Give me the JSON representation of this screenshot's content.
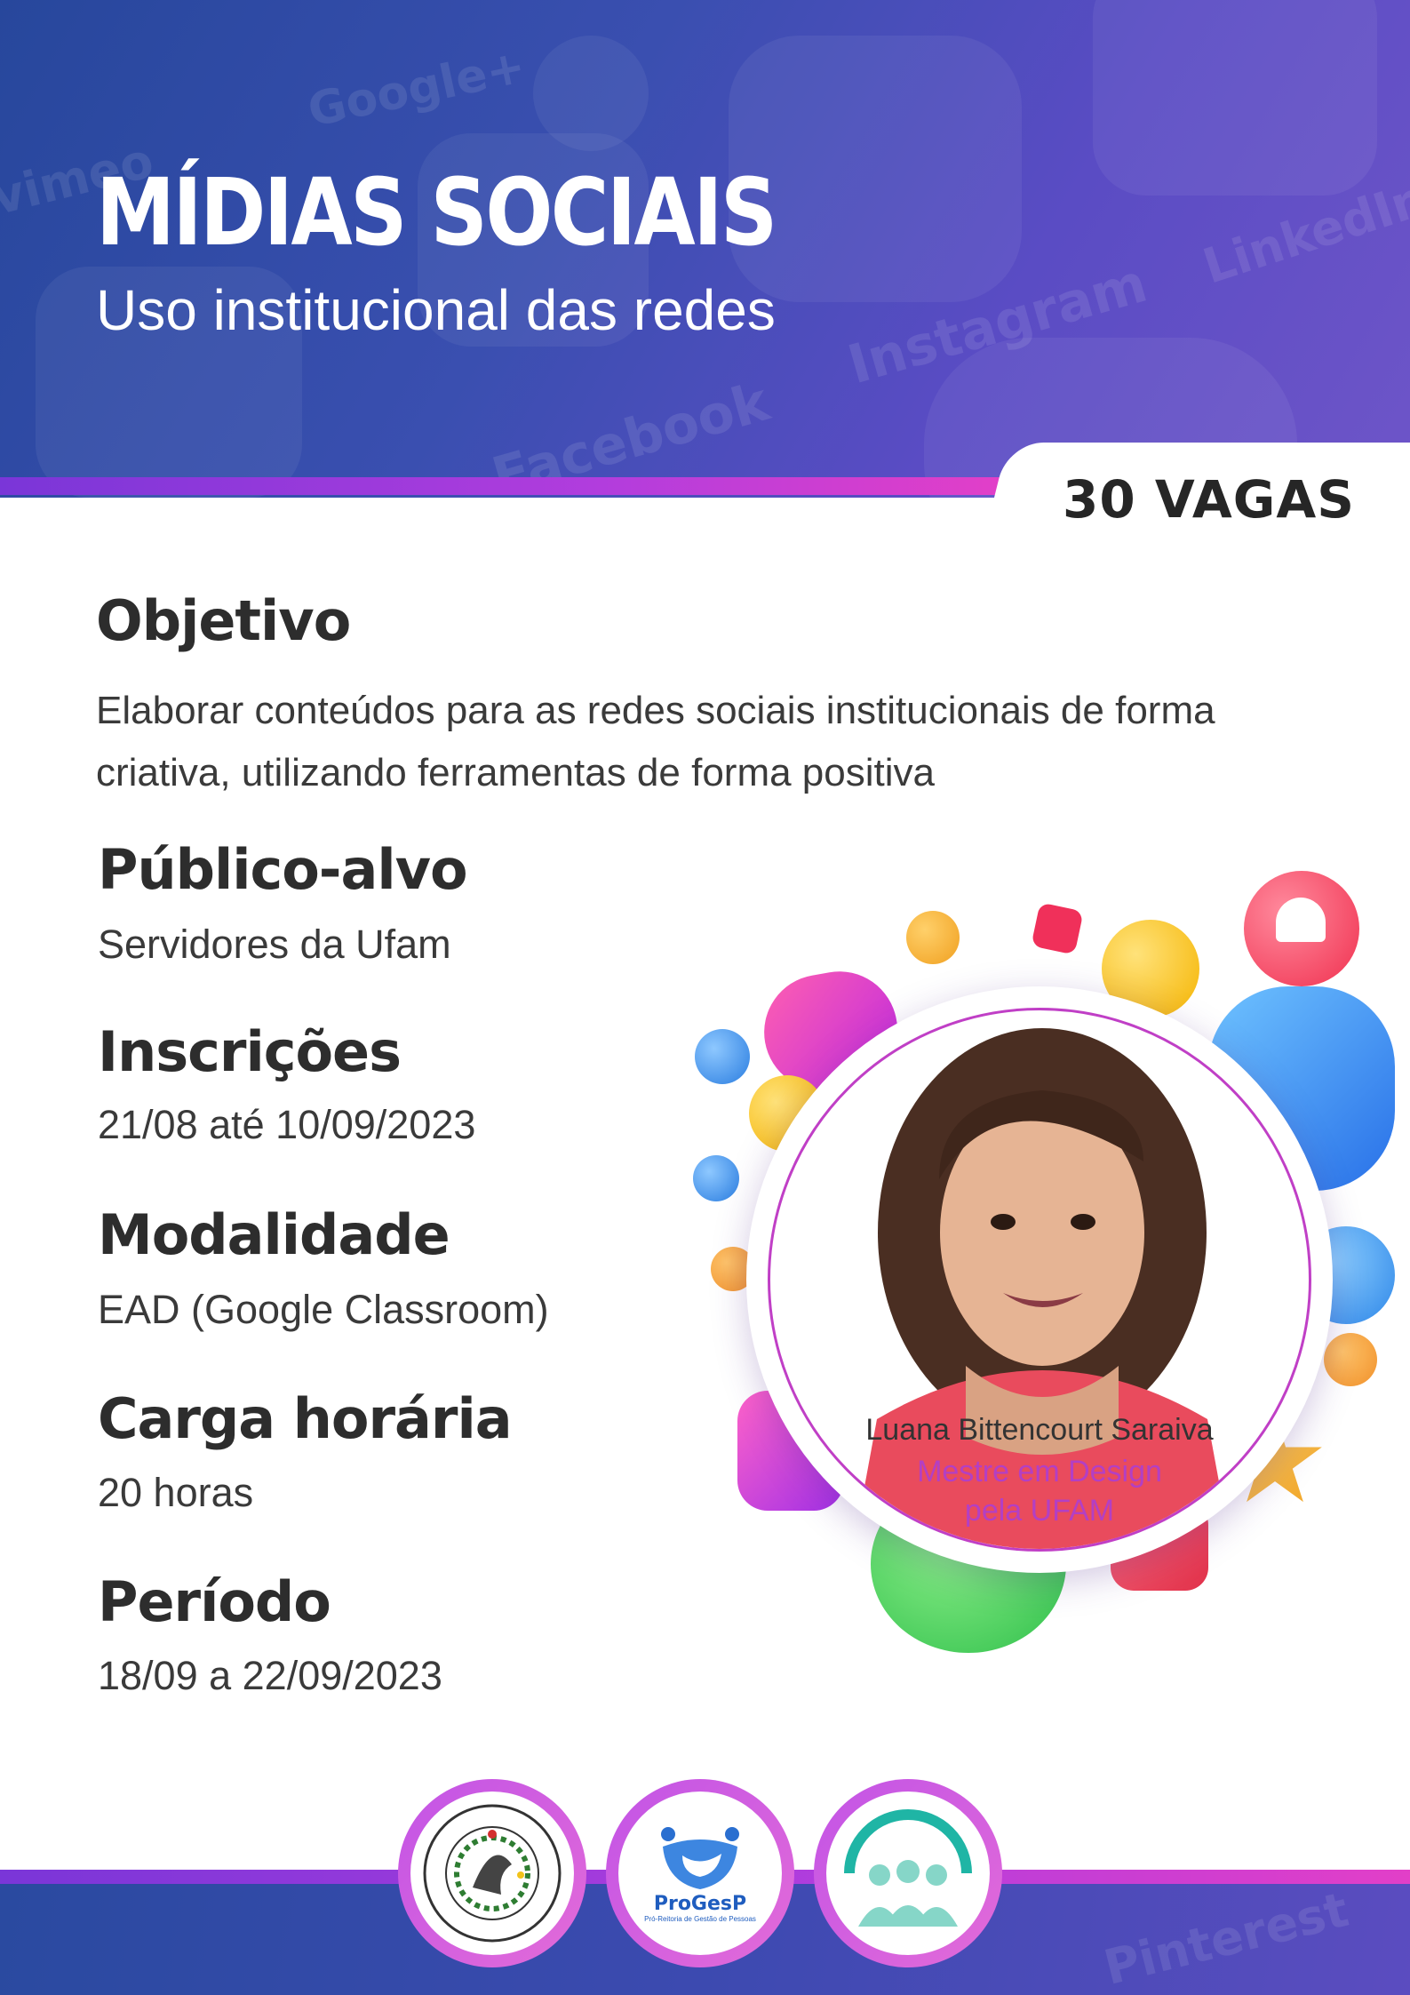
{
  "header": {
    "title": "MÍDIAS SOCIAIS",
    "subtitle": "Uso institucional das redes",
    "background_words": [
      "Google+",
      "vimeo",
      "Instagram",
      "Facebook",
      "LinkedIn"
    ],
    "vagas": "30 VAGAS"
  },
  "sections": {
    "objetivo": {
      "title": "Objetivo",
      "text": "Elaborar conteúdos para as redes sociais institucionais de forma criativa, utilizando ferramentas de forma positiva"
    },
    "publico": {
      "title": "Público-alvo",
      "text": "Servidores da Ufam"
    },
    "inscricoes": {
      "title": "Inscrições",
      "text": "21/08 até 10/09/2023"
    },
    "modalidade": {
      "title": "Modalidade",
      "text": "EAD (Google Classroom)"
    },
    "carga": {
      "title": "Carga horária",
      "text": "20 horas"
    },
    "periodo": {
      "title": "Período",
      "text": "18/09 a 22/09/2023"
    }
  },
  "instructor": {
    "name": "Luana Bittencourt Saraiva",
    "role_line1": "Mestre em Design",
    "role_line2": "pela UFAM"
  },
  "footer": {
    "logos": [
      "ufam-seal",
      "progesp-logo",
      "people-group-logo"
    ],
    "progesp_name": "ProGesP",
    "progesp_sub": "Pró-Reitoria de Gestão de Pessoas",
    "background_word": "Pinterest"
  },
  "colors": {
    "header_blue": "#27479c",
    "header_purple": "#6e55c8",
    "accent_magenta": "#b33fc4",
    "stripe_start": "#7a36d8",
    "stripe_end": "#e23fc8",
    "text_dark": "#2d2d2d"
  }
}
